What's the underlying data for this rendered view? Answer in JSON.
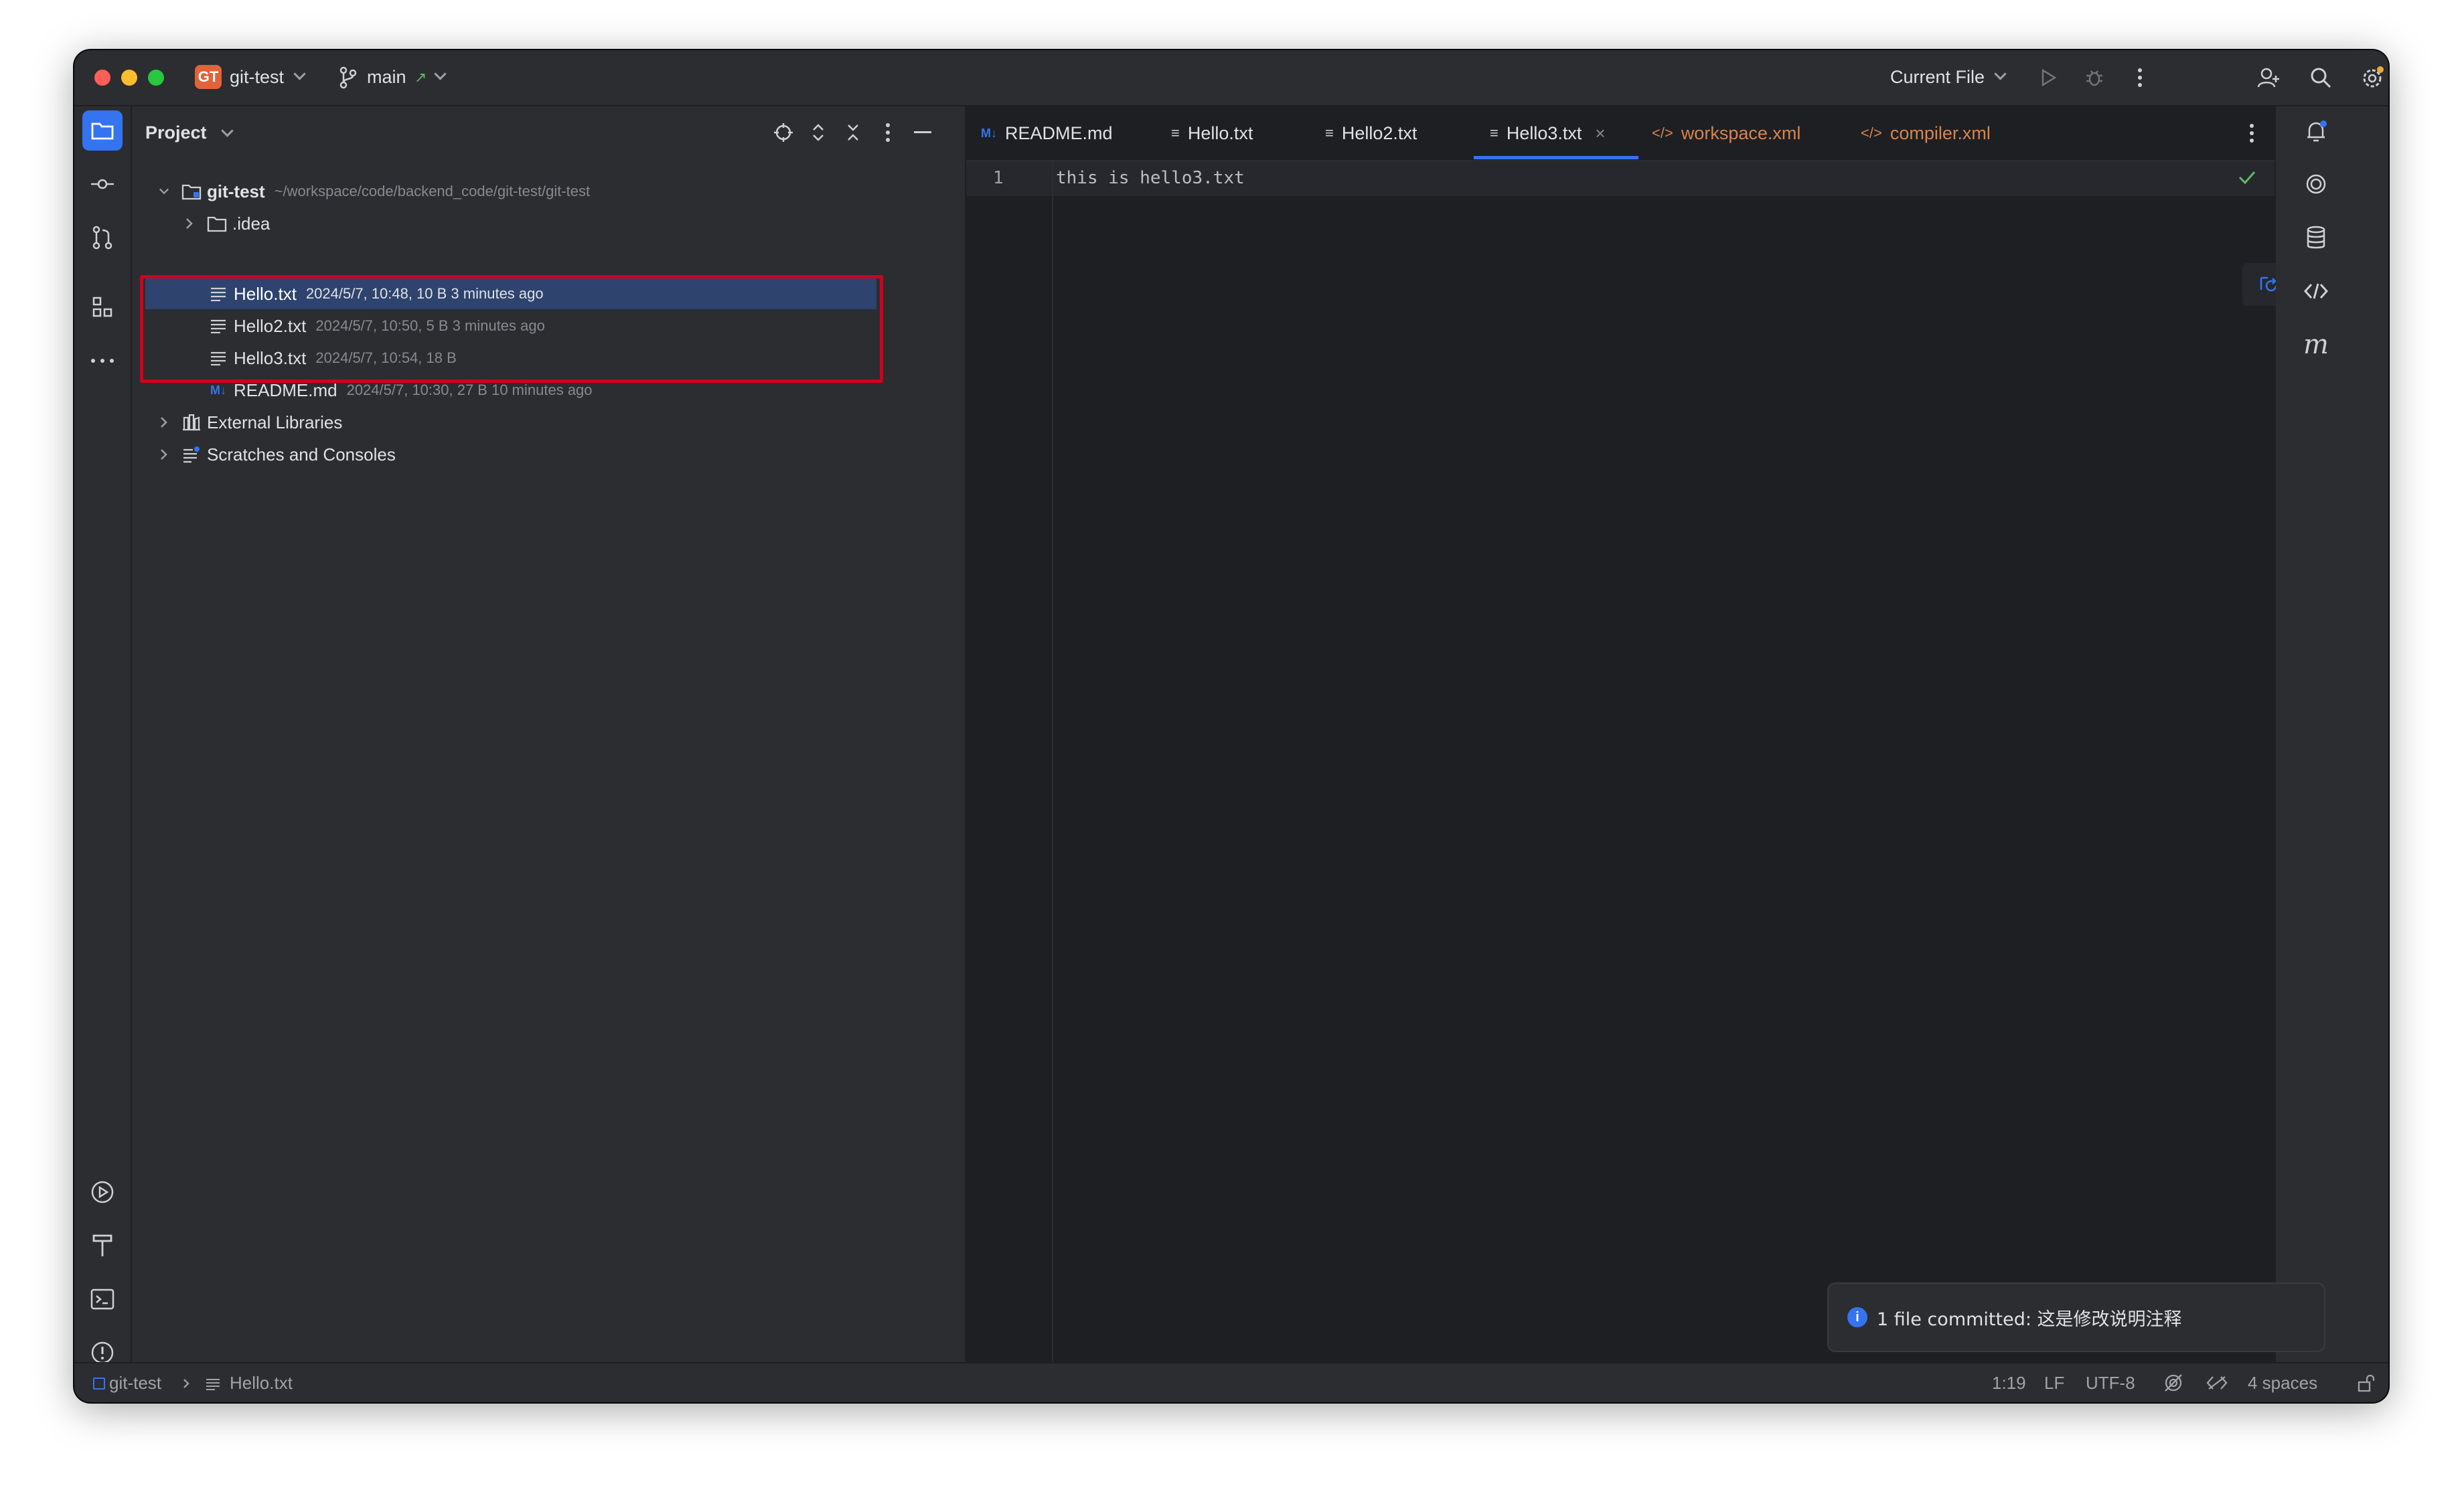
{
  "titlebar": {
    "project_badge": "GT",
    "project_name": "git-test",
    "branch": "main",
    "branch_arrow": "↗",
    "run_config": "Current File"
  },
  "project_panel": {
    "title": "Project",
    "tree": [
      {
        "name": "git-test",
        "meta": "~/workspace/code/backend_code/git-test/git-test",
        "icon": "module-folder-icon",
        "expanded": true
      },
      {
        "name": ".idea",
        "meta": "",
        "icon": "folder-icon",
        "expanded": false
      },
      {
        "name": "Hello.txt",
        "meta": "2024/5/7, 10:48, 10 B 3 minutes ago",
        "icon": "text-file-icon",
        "selected": true
      },
      {
        "name": "Hello2.txt",
        "meta": "2024/5/7, 10:50, 5 B 3 minutes ago",
        "icon": "text-file-icon"
      },
      {
        "name": "Hello3.txt",
        "meta": "2024/5/7, 10:54, 18 B",
        "icon": "text-file-icon"
      },
      {
        "name": "README.md",
        "meta": "2024/5/7, 10:30, 27 B 10 minutes ago",
        "icon": "markdown-file-icon"
      },
      {
        "name": "External Libraries",
        "meta": "",
        "icon": "library-icon",
        "expanded": false
      },
      {
        "name": "Scratches and Consoles",
        "meta": "",
        "icon": "scratches-icon",
        "expanded": false
      }
    ]
  },
  "editor": {
    "tabs": [
      {
        "label": "README.md",
        "icon": "M↓",
        "type": "md"
      },
      {
        "label": "Hello.txt",
        "icon": "≡",
        "type": "txt"
      },
      {
        "label": "Hello2.txt",
        "icon": "≡",
        "type": "txt"
      },
      {
        "label": "Hello3.txt",
        "icon": "≡",
        "type": "txt",
        "active": true,
        "close": "×"
      },
      {
        "label": "workspace.xml",
        "icon": "</>",
        "type": "xml"
      },
      {
        "label": "compiler.xml",
        "icon": "</>",
        "type": "xml"
      }
    ],
    "line_number": "1",
    "code_line": "this is hello3.txt",
    "float_close": "×"
  },
  "notification": {
    "text": "1 file committed: 这是修改说明注释",
    "info_glyph": "i"
  },
  "statusbar": {
    "breadcrumb_project": "git-test",
    "breadcrumb_file": "Hello.txt",
    "position": "1:19",
    "line_sep": "LF",
    "encoding": "UTF-8",
    "indent": "4 spaces"
  },
  "colors": {
    "accent": "#3574f0",
    "selection": "#2e436e",
    "highlight_box": "#d0021b",
    "xml_tab": "#d9844c"
  }
}
